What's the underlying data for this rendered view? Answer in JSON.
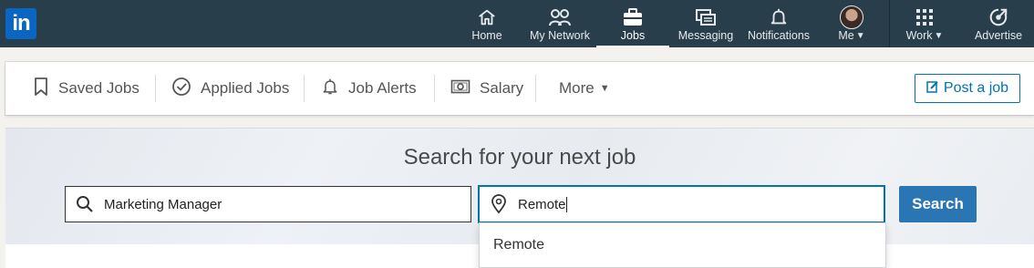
{
  "nav": {
    "logo_text": "in",
    "items": [
      {
        "label": "Home",
        "icon": "home-icon"
      },
      {
        "label": "My Network",
        "icon": "network-icon"
      },
      {
        "label": "Jobs",
        "icon": "briefcase-icon",
        "active": true
      },
      {
        "label": "Messaging",
        "icon": "messaging-icon"
      },
      {
        "label": "Notifications",
        "icon": "bell-icon"
      },
      {
        "label": "Me",
        "icon": "avatar",
        "dropdown": true
      },
      {
        "label": "Work",
        "icon": "grid-icon",
        "dropdown": true
      },
      {
        "label": "Advertise",
        "icon": "advertise-icon"
      }
    ]
  },
  "subnav": {
    "saved_jobs": "Saved Jobs",
    "applied_jobs": "Applied Jobs",
    "job_alerts": "Job Alerts",
    "salary": "Salary",
    "more": "More",
    "post_job": "Post a job"
  },
  "search": {
    "title": "Search for your next job",
    "keyword_value": "Marketing Manager",
    "location_value": "Remote",
    "button_label": "Search",
    "suggestions": [
      "Remote"
    ]
  },
  "colors": {
    "nav_bg": "#283e4a",
    "brand_blue": "#0073b1",
    "search_button": "#2a75b4"
  }
}
